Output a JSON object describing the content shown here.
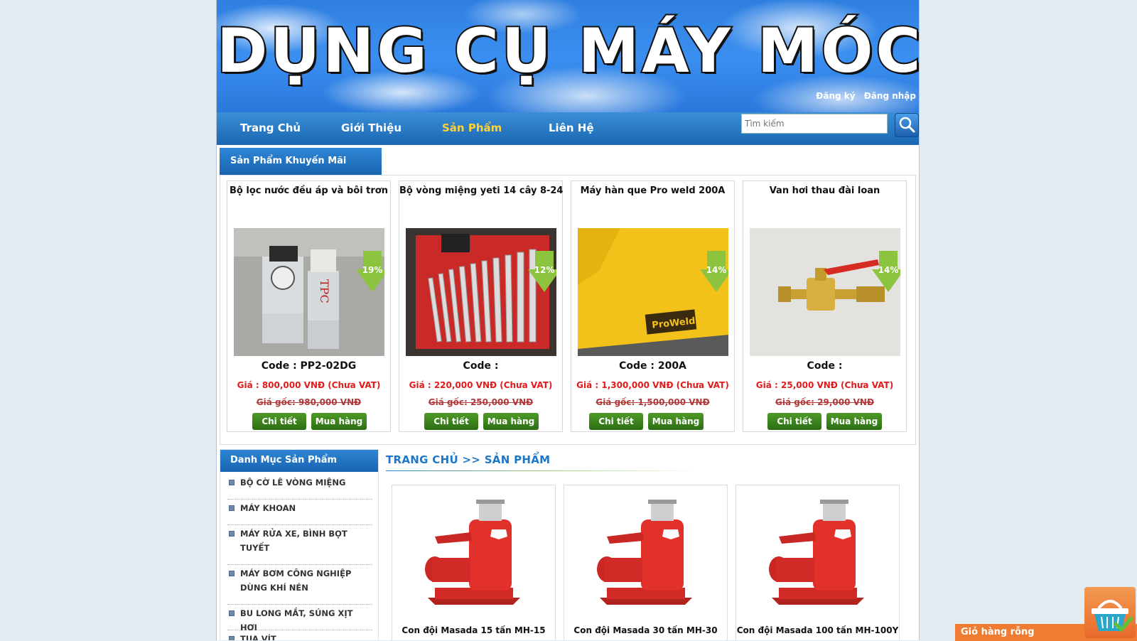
{
  "header": {
    "site_title": "DỤNG CỤ MÁY MÓC",
    "register": "Đăng ký",
    "login": "Đăng nhập"
  },
  "nav": {
    "items": [
      {
        "label": "Trang Chủ"
      },
      {
        "label": "Giới Thiệu"
      },
      {
        "label": "Sản Phẩm"
      },
      {
        "label": "Liên Hệ"
      }
    ],
    "active": "Sản Phẩm",
    "search_placeholder": "Tìm kiếm"
  },
  "promo": {
    "title": "Sản Phẩm Khuyến Mãi",
    "products": [
      {
        "name": "Bộ lọc nước đều áp và bôi trơn",
        "discount": "19%",
        "code": "Code : PP2-02DG",
        "price": "Giá : 800,000 VNĐ (Chưa VAT)",
        "original": "Giá gốc: 980,000 VNĐ",
        "detail": "Chi tiết",
        "buy": "Mua hàng"
      },
      {
        "name": "Bộ vòng miệng yeti 14 cây 8-24",
        "discount": "12%",
        "code": "Code :",
        "price": "Giá : 220,000 VNĐ (Chưa VAT)",
        "original": "Giá gốc: 250,000 VNĐ",
        "detail": "Chi tiết",
        "buy": "Mua hàng"
      },
      {
        "name": "Máy hàn que Pro weld 200A",
        "discount": "14%",
        "code": "Code : 200A",
        "price": "Giá : 1,300,000 VNĐ (Chưa VAT)",
        "original": "Giá gốc: 1,500,000 VNĐ",
        "detail": "Chi tiết",
        "buy": "Mua hàng"
      },
      {
        "name": "Van hơi thau đài loan",
        "discount": "14%",
        "code": "Code :",
        "price": "Giá : 25,000 VNĐ (Chưa VAT)",
        "original": "Giá gốc: 29,000 VNĐ",
        "detail": "Chi tiết",
        "buy": "Mua hàng"
      }
    ]
  },
  "sidebar": {
    "title": "Danh Mục Sản Phẩm",
    "items": [
      {
        "label": "BỘ CỜ LÊ VÒNG MIỆNG"
      },
      {
        "label": "MÁY KHOAN"
      },
      {
        "label": "MÁY RỬA XE, BÌNH BỌT"
      },
      {
        "label": "TUYẾT"
      },
      {
        "label": "MÁY BƠM CÔNG NGHIỆP"
      },
      {
        "label": "DÙNG KHÍ NÉN"
      },
      {
        "label": "BU LONG MẮT, SÚNG XỊT HƠI"
      },
      {
        "label": "TUA VÍT"
      }
    ]
  },
  "main": {
    "breadcrumb": "TRANG CHỦ >> SẢN PHẨM",
    "products": [
      {
        "name": "Con đội Masada 15 tấn MH-15"
      },
      {
        "name": "Con đội Masada 30 tấn MH-30"
      },
      {
        "name": "Con đội Masada 100 tấn MH-100Y"
      }
    ]
  },
  "cart": {
    "label": "Giỏ hàng rỗng"
  }
}
